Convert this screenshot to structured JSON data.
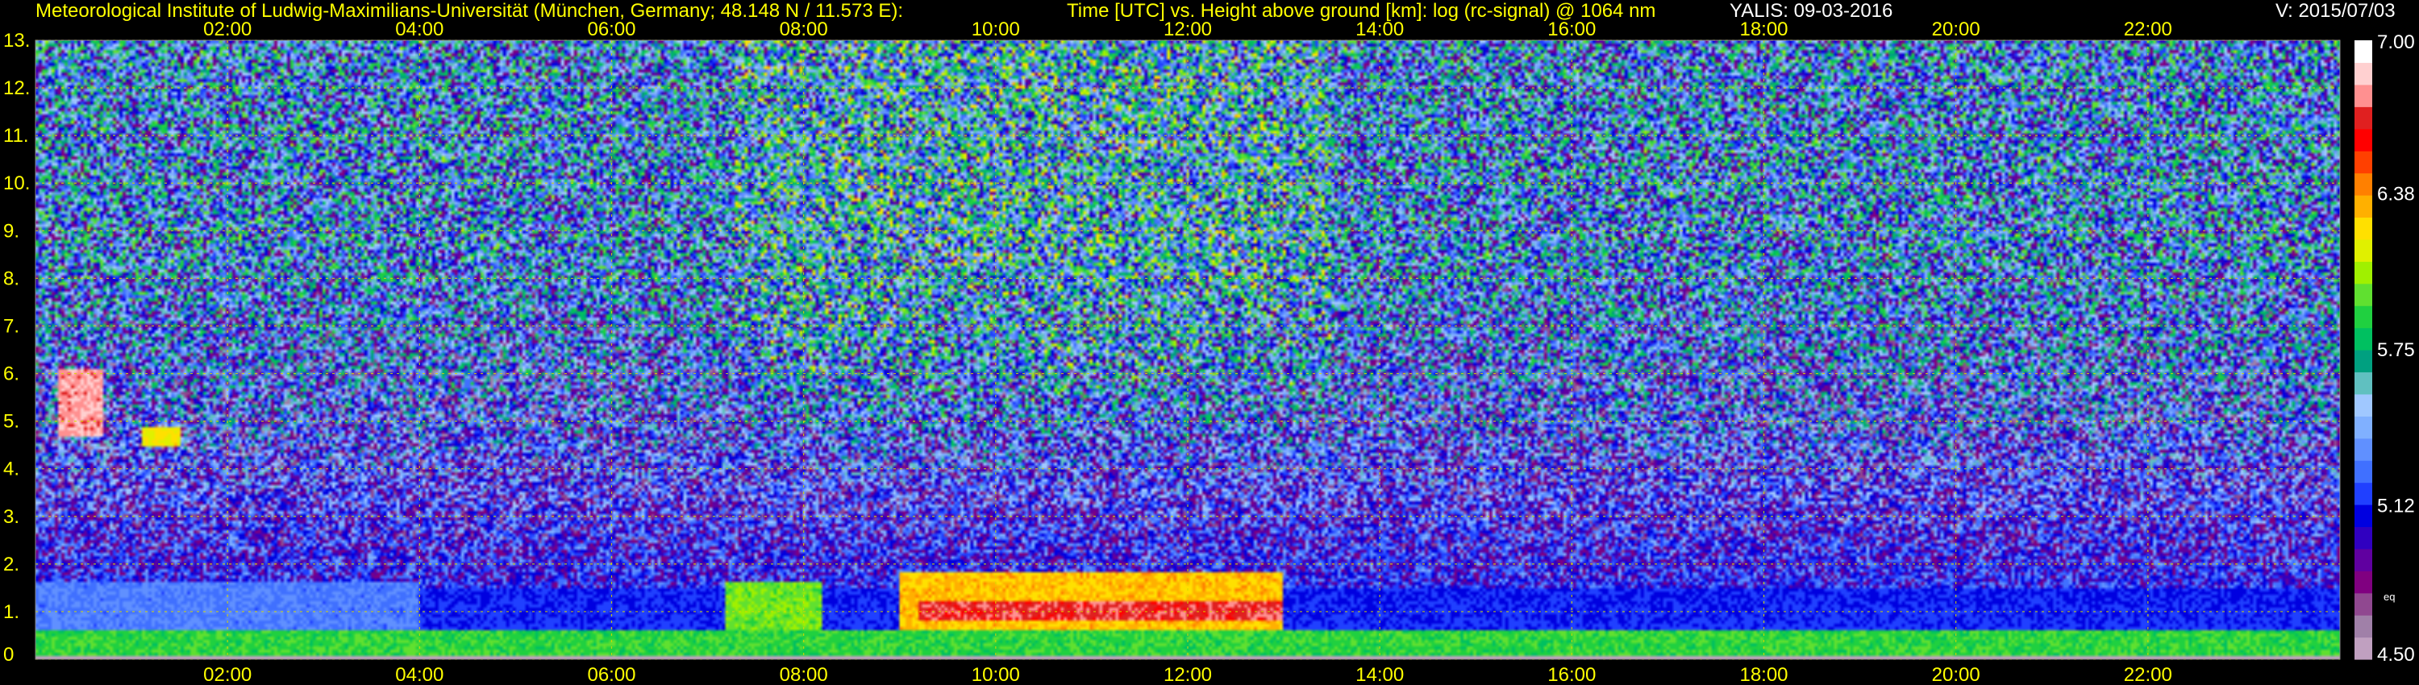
{
  "header": {
    "institute": "Meteorological Institute of Ludwig-Maximilians-Universität (München, Germany; 48.148 N / 11.573 E):",
    "plot_title": "Time [UTC] vs. Height above ground [km]: log (rc-signal) @ 1064 nm",
    "instrument_date": "YALIS: 09-03-2016",
    "version": "V: 2015/07/03"
  },
  "colors": {
    "text": "#ffff00",
    "grid": "#d8d800",
    "background": "#000000"
  },
  "chart_data": {
    "type": "heatmap",
    "x_ticks_top": [
      "02:00",
      "04:00",
      "06:00",
      "08:00",
      "10:00",
      "12:00",
      "14:00",
      "16:00",
      "18:00",
      "20:00",
      "22:00"
    ],
    "x_ticks_bottom": [
      "02:00",
      "04:00",
      "06:00",
      "08:00",
      "10:00",
      "12:00",
      "14:00",
      "16:00",
      "18:00",
      "20:00",
      "22:00"
    ],
    "x_tick_hours": [
      2,
      4,
      6,
      8,
      10,
      12,
      14,
      16,
      18,
      20,
      22
    ],
    "xlim_hours": [
      0,
      24
    ],
    "y_ticks": [
      "0",
      "1.",
      "2.",
      "3.",
      "4.",
      "5.",
      "6.",
      "7.",
      "8.",
      "9.",
      "10.",
      "11.",
      "12.",
      "13."
    ],
    "y_tick_values": [
      0,
      1,
      2,
      3,
      4,
      5,
      6,
      7,
      8,
      9,
      10,
      11,
      12,
      13
    ],
    "ylim_km": [
      0,
      13
    ],
    "grid": true,
    "colorbar": {
      "range": [
        4.5,
        7.0
      ],
      "labels": [
        "7.00",
        "6.38",
        "5.75",
        "5.12",
        "4.50"
      ],
      "label_values": [
        7.0,
        6.38,
        5.75,
        5.12,
        4.5
      ],
      "extra_label": "eq",
      "colors": [
        "#c0a0c0",
        "#a080a8",
        "#904890",
        "#800080",
        "#6000a0",
        "#3000c0",
        "#0000e0",
        "#2040ff",
        "#4070ff",
        "#6090ff",
        "#80b0ff",
        "#a0c8ff",
        "#60c0c0",
        "#00a080",
        "#00c060",
        "#20d040",
        "#60e030",
        "#a0f000",
        "#e0f000",
        "#ffe000",
        "#ffb000",
        "#ff8000",
        "#ff4000",
        "#ff0000",
        "#e02020",
        "#ff9090",
        "#ffd0d0",
        "#ffffff"
      ]
    },
    "features": [
      {
        "kind": "boundary_layer",
        "t0": 0.0,
        "t1": 24.0,
        "z0": 0.05,
        "z1": 0.6,
        "value": 5.9
      },
      {
        "kind": "residual_layer",
        "t0": 0.0,
        "t1": 4.0,
        "z0": 0.6,
        "z1": 1.6,
        "value": 5.3
      },
      {
        "kind": "aerosol_layer",
        "t0": 9.0,
        "t1": 13.0,
        "z0": 0.6,
        "z1": 1.8,
        "value": 6.3
      },
      {
        "kind": "aerosol_core",
        "t0": 9.2,
        "t1": 13.0,
        "z0": 0.8,
        "z1": 1.2,
        "value": 6.7
      },
      {
        "kind": "cloud_patch",
        "t0": 0.25,
        "t1": 0.7,
        "z0": 4.7,
        "z1": 6.1,
        "value": 6.8
      },
      {
        "kind": "cloud_patch",
        "t0": 1.1,
        "t1": 1.5,
        "z0": 4.5,
        "z1": 4.9,
        "value": 6.2
      },
      {
        "kind": "elevated_layer",
        "t0": 7.2,
        "t1": 8.2,
        "z0": 0.6,
        "z1": 1.6,
        "value": 6.0
      },
      {
        "kind": "noise_bright",
        "t0": 7.3,
        "t1": 13.5,
        "z0": 3.5,
        "z1": 13.0,
        "value": 6.4
      }
    ]
  }
}
